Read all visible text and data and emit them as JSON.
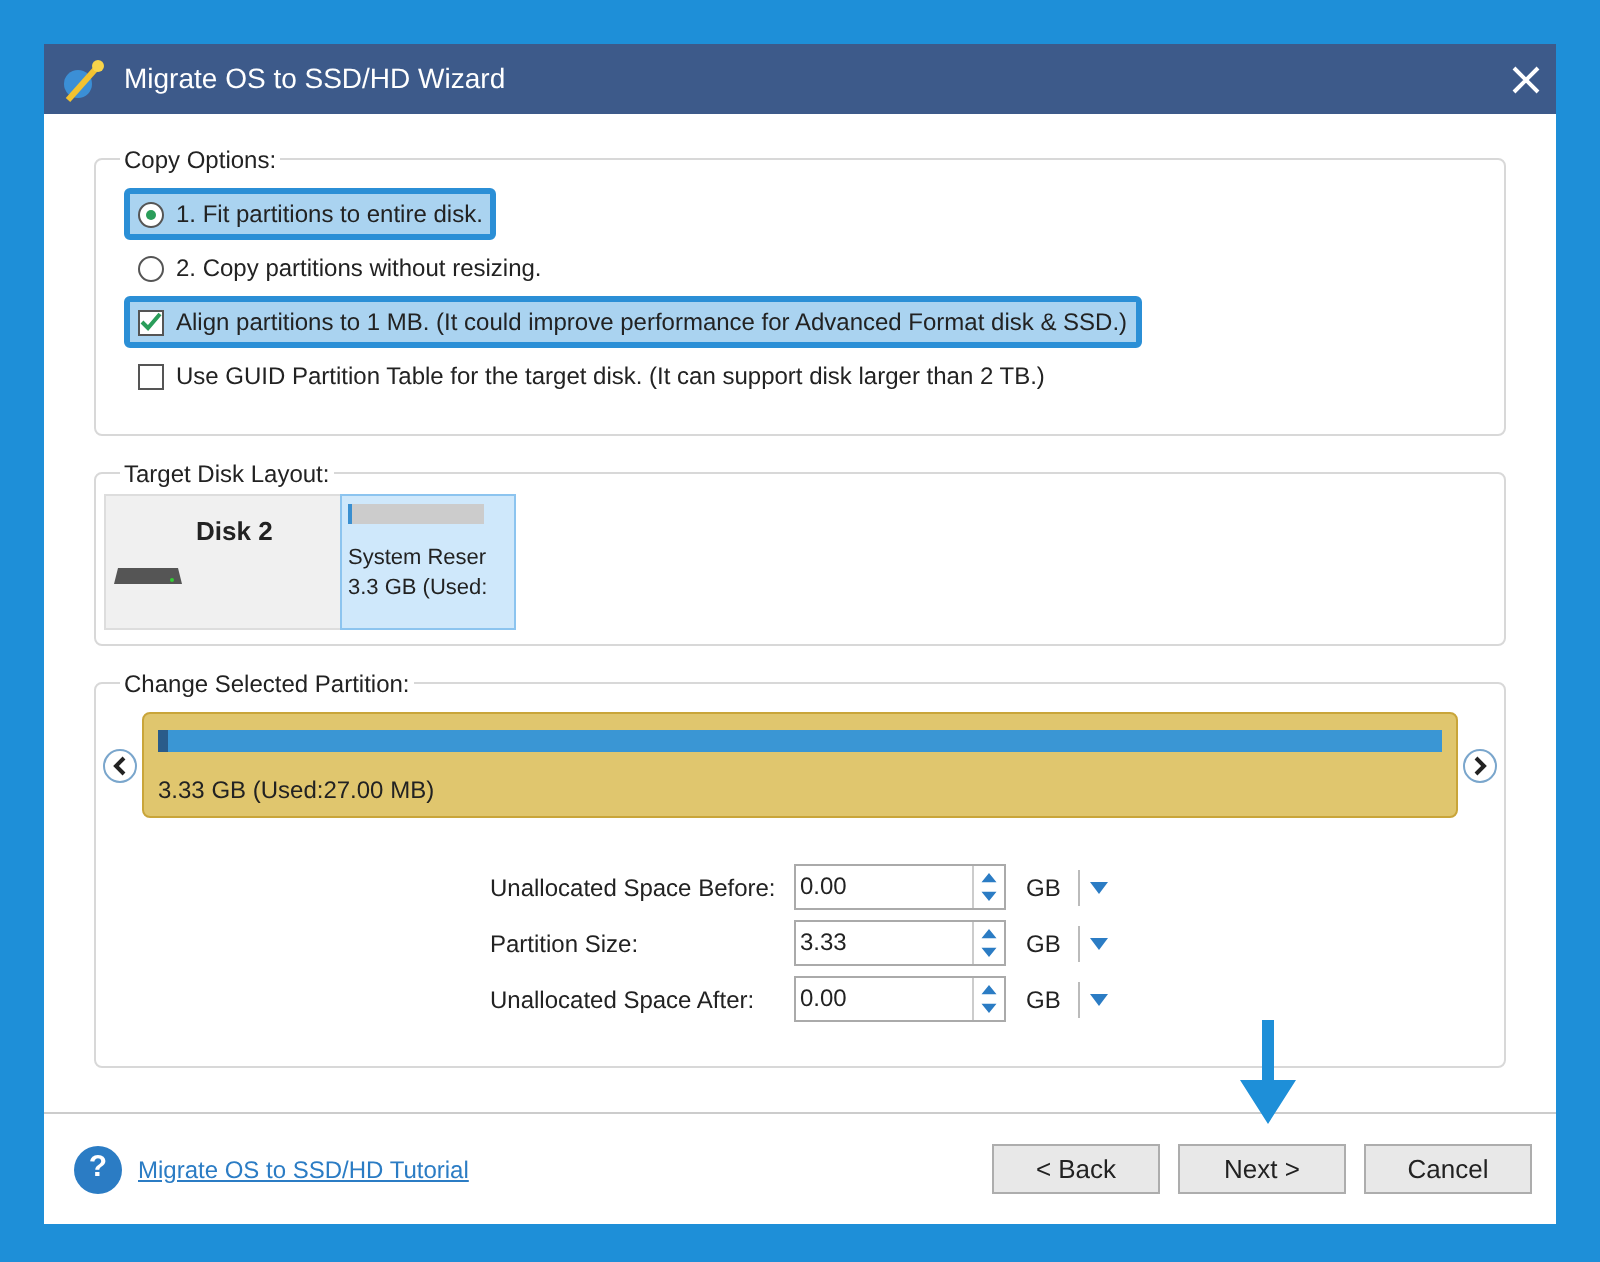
{
  "window": {
    "title": "Migrate OS to SSD/HD Wizard"
  },
  "copy_options": {
    "title": "Copy Options:",
    "options": [
      {
        "kind": "radio",
        "label": "1. Fit partitions to entire disk.",
        "selected": true,
        "highlighted": true
      },
      {
        "kind": "radio",
        "label": "2. Copy partitions without resizing.",
        "selected": false,
        "highlighted": false
      },
      {
        "kind": "checkbox",
        "label": "Align partitions to 1 MB.  (It could improve performance for Advanced Format disk & SSD.)",
        "checked": true,
        "highlighted": true
      },
      {
        "kind": "checkbox",
        "label": "Use GUID Partition Table for the target disk. (It can support disk larger than 2 TB.)",
        "checked": false,
        "highlighted": false
      }
    ]
  },
  "target_disk_layout": {
    "title": "Target Disk Layout:",
    "disk": "Disk 2",
    "partition": {
      "name": "System Reser",
      "size": "3.3 GB (Used:",
      "selected": true
    }
  },
  "change_selected_partition": {
    "title": "Change Selected Partition:",
    "partition_label": "3.33 GB (Used:27.00 MB)",
    "fields": [
      {
        "label": "Unallocated Space Before:",
        "value": "0.00",
        "unit": "GB"
      },
      {
        "label": "Partition Size:",
        "value": "3.33",
        "unit": "GB"
      },
      {
        "label": "Unallocated Space After:",
        "value": "0.00",
        "unit": "GB"
      }
    ]
  },
  "footer": {
    "help_icon": "?",
    "tutorial_link": "Migrate OS to SSD/HD Tutorial",
    "buttons": [
      "< Back",
      "Next >",
      "Cancel"
    ]
  }
}
